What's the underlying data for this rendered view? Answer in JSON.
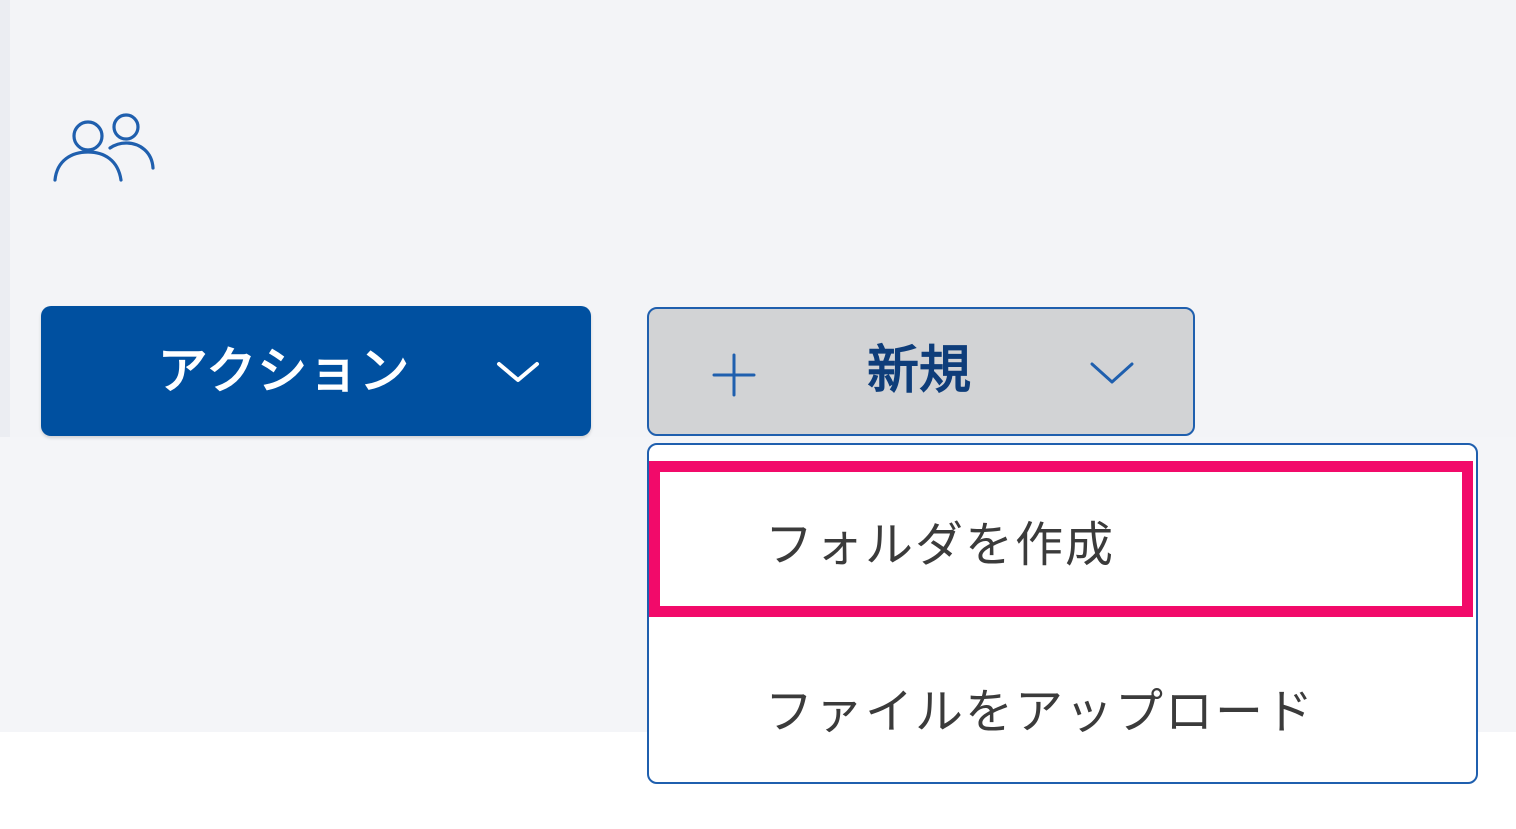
{
  "toolbar": {
    "users_icon": "people-icon",
    "actions_button": {
      "label": "アクション",
      "icon": "chevron-down-icon",
      "background_color": "#0050a0"
    },
    "new_button": {
      "label": "新規",
      "leading_icon": "plus-icon",
      "trailing_icon": "chevron-down-icon",
      "border_color": "#1f5fae"
    }
  },
  "new_menu": {
    "expanded": true,
    "items": [
      {
        "label": "フォルダを作成",
        "highlighted": true
      },
      {
        "label": "ファイルをアップロード",
        "highlighted": false
      }
    ]
  },
  "highlight": {
    "color": "#f20a6a",
    "target": "フォルダを作成"
  }
}
